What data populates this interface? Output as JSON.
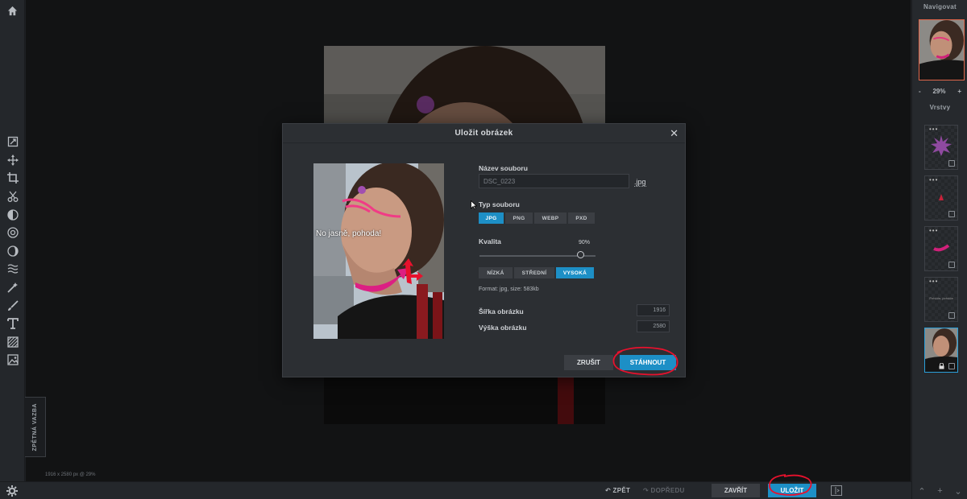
{
  "left_toolbar": {
    "feedback_label": "ZPĚTNÁ VAZBA"
  },
  "canvas": {
    "size_info": "1916 x 2580 px @ 29%"
  },
  "right_panel": {
    "navigate_title": "Navigovat",
    "zoom_minus": "-",
    "zoom_value": "29%",
    "zoom_plus": "+",
    "layers_title": "Vrstvy",
    "layer_text_thumb": "Pohoda, pohoda"
  },
  "bottom_bar": {
    "undo_label": "ZPĚT",
    "redo_label": "DOPŘEDU",
    "close_label": "ZAVŘÍT",
    "save_label": "ULOŽIT"
  },
  "modal": {
    "title": "Uložit obrázek",
    "close_glyph": "✕",
    "preview_caption": "No jasně, pohoda!",
    "filename_label": "Název souboru",
    "filename_value": "DSC_0223",
    "extension": ".jpg",
    "filetype_label": "Typ souboru",
    "filetypes": [
      "JPG",
      "PNG",
      "WEBP",
      "PXD"
    ],
    "filetype_selected": "JPG",
    "quality_label": "Kvalita",
    "quality_value": "90%",
    "quality_fraction": 0.9,
    "quality_presets": [
      "NÍZKÁ",
      "STŘEDNÍ",
      "VYSOKÁ"
    ],
    "quality_preset_selected": "VYSOKÁ",
    "format_info": "Format: jpg, size: 583kb",
    "width_label": "Šířka obrázku",
    "width_value": "1916",
    "height_label": "Výška obrázku",
    "height_value": "2580",
    "cancel_label": "ZRUŠIT",
    "download_label": "STÁHNOUT"
  },
  "colors": {
    "accent": "#1d8fc6",
    "annotation_red": "#e8112d"
  }
}
